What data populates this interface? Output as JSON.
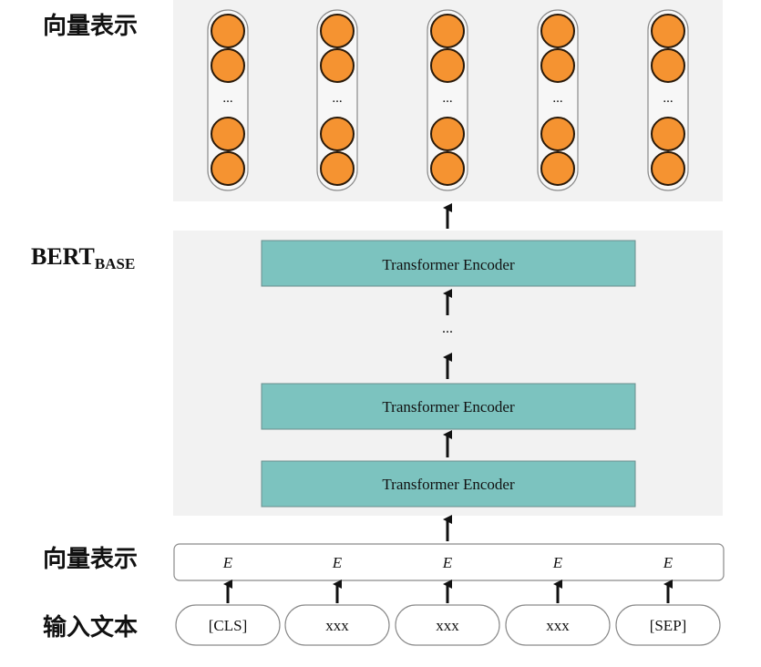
{
  "labels": {
    "output_vectors": "向量表示",
    "bert": "BERT",
    "bert_sub": "BASE",
    "input_vectors": "向量表示",
    "input_text": "输入文本"
  },
  "encoders": {
    "top": "Transformer Encoder",
    "middle": "Transformer Encoder",
    "bottom": "Transformer Encoder",
    "ellipsis": "..."
  },
  "columns": [
    {
      "embedding": "E",
      "token": "[CLS]",
      "ellipsis": "..."
    },
    {
      "embedding": "E",
      "token": "xxx",
      "ellipsis": "..."
    },
    {
      "embedding": "E",
      "token": "xxx",
      "ellipsis": "..."
    },
    {
      "embedding": "E",
      "token": "xxx",
      "ellipsis": "..."
    },
    {
      "embedding": "E",
      "token": "[SEP]",
      "ellipsis": "..."
    }
  ],
  "colors": {
    "panel": "#f2f2f2",
    "encoder_fill": "#7cc3bf",
    "encoder_stroke": "#6a8e8c",
    "node_fill": "#f59331",
    "node_stroke": "#2a1a0a",
    "arrow": "#111111"
  }
}
